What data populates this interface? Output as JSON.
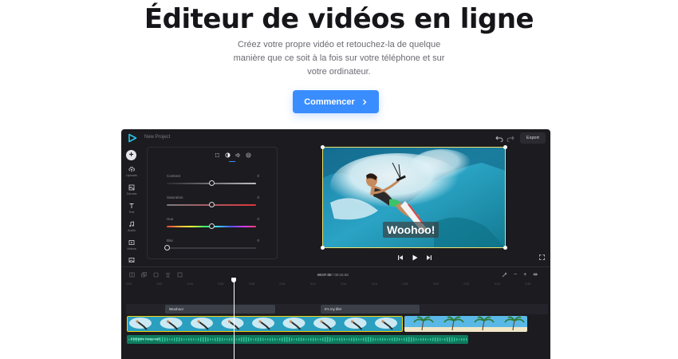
{
  "hero": {
    "title": "Éditeur de vidéos en ligne",
    "subtitle": "Créez votre propre vidéo et retouchez-la de quelque manière que ce soit à la fois sur votre téléphone et sur votre ordinateur.",
    "cta_label": "Commencer"
  },
  "editor": {
    "project_name": "New Project",
    "export_label": "Export",
    "rail": [
      {
        "label": "Uploads",
        "icon": "cloud-upload-icon"
      },
      {
        "label": "Canvas",
        "icon": "canvas-icon"
      },
      {
        "label": "Text",
        "icon": "text-icon"
      },
      {
        "label": "Audio",
        "icon": "music-note-icon"
      },
      {
        "label": "Videos",
        "icon": "video-icon"
      },
      {
        "label": "",
        "icon": "image-icon"
      }
    ],
    "panel": {
      "tabs": [
        "crop-icon",
        "adjust-icon",
        "volume-icon",
        "speed-icon"
      ],
      "active_tab": 1,
      "sliders": [
        {
          "label": "Contrast",
          "value": "0",
          "level": 0.5
        },
        {
          "label": "Saturation",
          "value": "0",
          "level": 0.5
        },
        {
          "label": "Hue",
          "value": "0",
          "level": 0.5
        },
        {
          "label": "Blur",
          "value": "0",
          "level": 0.0
        }
      ]
    },
    "preview": {
      "caption": "Woohoo!"
    },
    "timeline": {
      "current_time": "00:07.00",
      "separator": "/",
      "total_time": "00:15.50",
      "text_clips": [
        "Woohoo!",
        "It's my life!"
      ],
      "audio_clip_label": "Energetic Song.mp3",
      "ticks": [
        "0:00",
        "0:02",
        "0:04",
        "0:06",
        "0:08",
        "0:10",
        "0:12",
        "0:14",
        "0:16",
        "0:18",
        "0:20",
        "0:22",
        "0:24",
        "0:26"
      ]
    },
    "colors": {
      "accent": "#3a8dff",
      "selection": "#f0e26a",
      "audio": "#0f7a5e",
      "editor_bg": "#1c1c20"
    }
  }
}
